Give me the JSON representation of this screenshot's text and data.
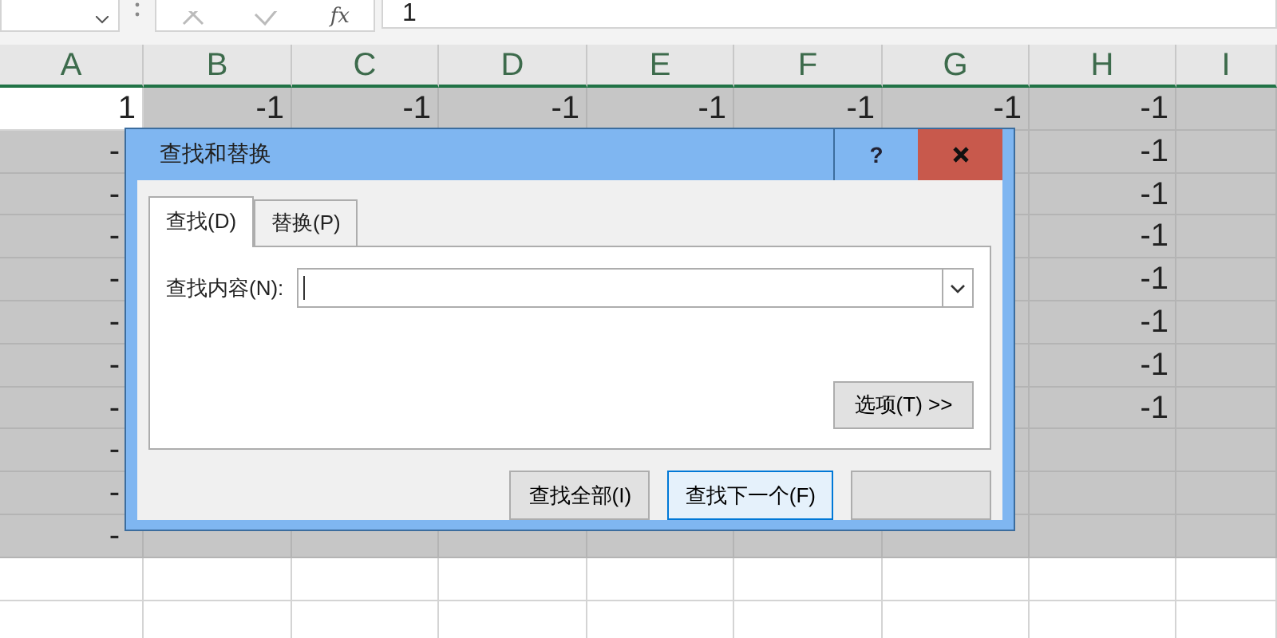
{
  "formula_bar": {
    "function_label": "fx",
    "value": "1"
  },
  "columns": [
    "A",
    "B",
    "C",
    "D",
    "E",
    "F",
    "G",
    "H",
    "I"
  ],
  "rows": [
    {
      "cells": [
        {
          "text": "1",
          "selected": false
        },
        {
          "text": "-1",
          "selected": true
        },
        {
          "text": "-1",
          "selected": true
        },
        {
          "text": "-1",
          "selected": true
        },
        {
          "text": "-1",
          "selected": true
        },
        {
          "text": "-1",
          "selected": true
        },
        {
          "text": "-1",
          "selected": true
        },
        {
          "text": "-1",
          "selected": true
        },
        {
          "selected": true
        }
      ]
    },
    {
      "cells": [
        {
          "text": "-",
          "selected": true,
          "cut": true
        },
        null,
        null,
        null,
        null,
        null,
        {
          "selected": true
        },
        {
          "text": "-1",
          "selected": true
        },
        {
          "selected": true
        }
      ]
    },
    {
      "cells": [
        {
          "text": "-",
          "selected": true,
          "cut": true
        },
        null,
        null,
        null,
        null,
        null,
        {
          "selected": true
        },
        {
          "text": "-1",
          "selected": true
        },
        {
          "selected": true
        }
      ]
    },
    {
      "cells": [
        {
          "text": "-",
          "selected": true,
          "cut": true
        },
        null,
        null,
        null,
        null,
        null,
        {
          "selected": true
        },
        {
          "text": "-1",
          "selected": true
        },
        {
          "selected": true
        }
      ]
    },
    {
      "cells": [
        {
          "text": "-",
          "selected": true,
          "cut": true
        },
        null,
        null,
        null,
        null,
        null,
        {
          "selected": true
        },
        {
          "text": "-1",
          "selected": true
        },
        {
          "selected": true
        }
      ]
    },
    {
      "cells": [
        {
          "text": "-",
          "selected": true,
          "cut": true
        },
        null,
        null,
        null,
        null,
        null,
        {
          "selected": true
        },
        {
          "text": "-1",
          "selected": true
        },
        {
          "selected": true
        }
      ]
    },
    {
      "cells": [
        {
          "text": "-",
          "selected": true,
          "cut": true
        },
        null,
        null,
        null,
        null,
        null,
        {
          "selected": true
        },
        {
          "text": "-1",
          "selected": true
        },
        {
          "selected": true
        }
      ]
    },
    {
      "cells": [
        {
          "text": "-",
          "selected": true,
          "cut": true
        },
        null,
        null,
        null,
        null,
        null,
        {
          "selected": true
        },
        {
          "text": "-1",
          "selected": true
        },
        {
          "selected": true
        }
      ]
    },
    {
      "cells": [
        {
          "text": "-",
          "selected": true,
          "cut": true
        },
        null,
        null,
        null,
        null,
        null,
        {
          "selected": true
        },
        {
          "selected": true
        },
        {
          "selected": true
        }
      ]
    },
    {
      "cells": [
        {
          "text": "-",
          "selected": true,
          "cut": true
        },
        null,
        null,
        null,
        null,
        null,
        {
          "selected": true
        },
        {
          "selected": true
        },
        {
          "selected": true
        }
      ]
    },
    {
      "cells": [
        {
          "text": "-",
          "selected": true,
          "cut": true
        },
        {
          "selected": true
        },
        {
          "selected": true
        },
        {
          "selected": true
        },
        {
          "selected": true
        },
        {
          "selected": true
        },
        {
          "selected": true
        },
        {
          "selected": true
        },
        {
          "selected": true
        }
      ]
    },
    {
      "cells": [
        {
          "selected": false
        },
        {
          "selected": false
        },
        {
          "selected": false
        },
        {
          "selected": false
        },
        {
          "selected": false
        },
        {
          "selected": false
        },
        {
          "selected": false
        },
        {
          "selected": false
        },
        {
          "selected": false
        }
      ]
    },
    {
      "cells": [
        {
          "selected": false
        },
        {
          "selected": false
        },
        {
          "selected": false
        },
        {
          "selected": false
        },
        {
          "selected": false
        },
        {
          "selected": false
        },
        {
          "selected": false
        },
        {
          "selected": false
        },
        {
          "selected": false
        }
      ]
    }
  ],
  "dialog": {
    "title": "查找和替换",
    "help": "?",
    "tabs": [
      {
        "label": "查找(D)",
        "selected": true
      },
      {
        "label": "替换(P)",
        "selected": false
      }
    ],
    "find_label": "查找内容(N):",
    "options_button": "选项(T) >>",
    "buttons": [
      {
        "label": "查找全部(I)",
        "selected": false
      },
      {
        "label": "查找下一个(F)",
        "selected": true
      },
      {
        "selected": false
      }
    ]
  }
}
